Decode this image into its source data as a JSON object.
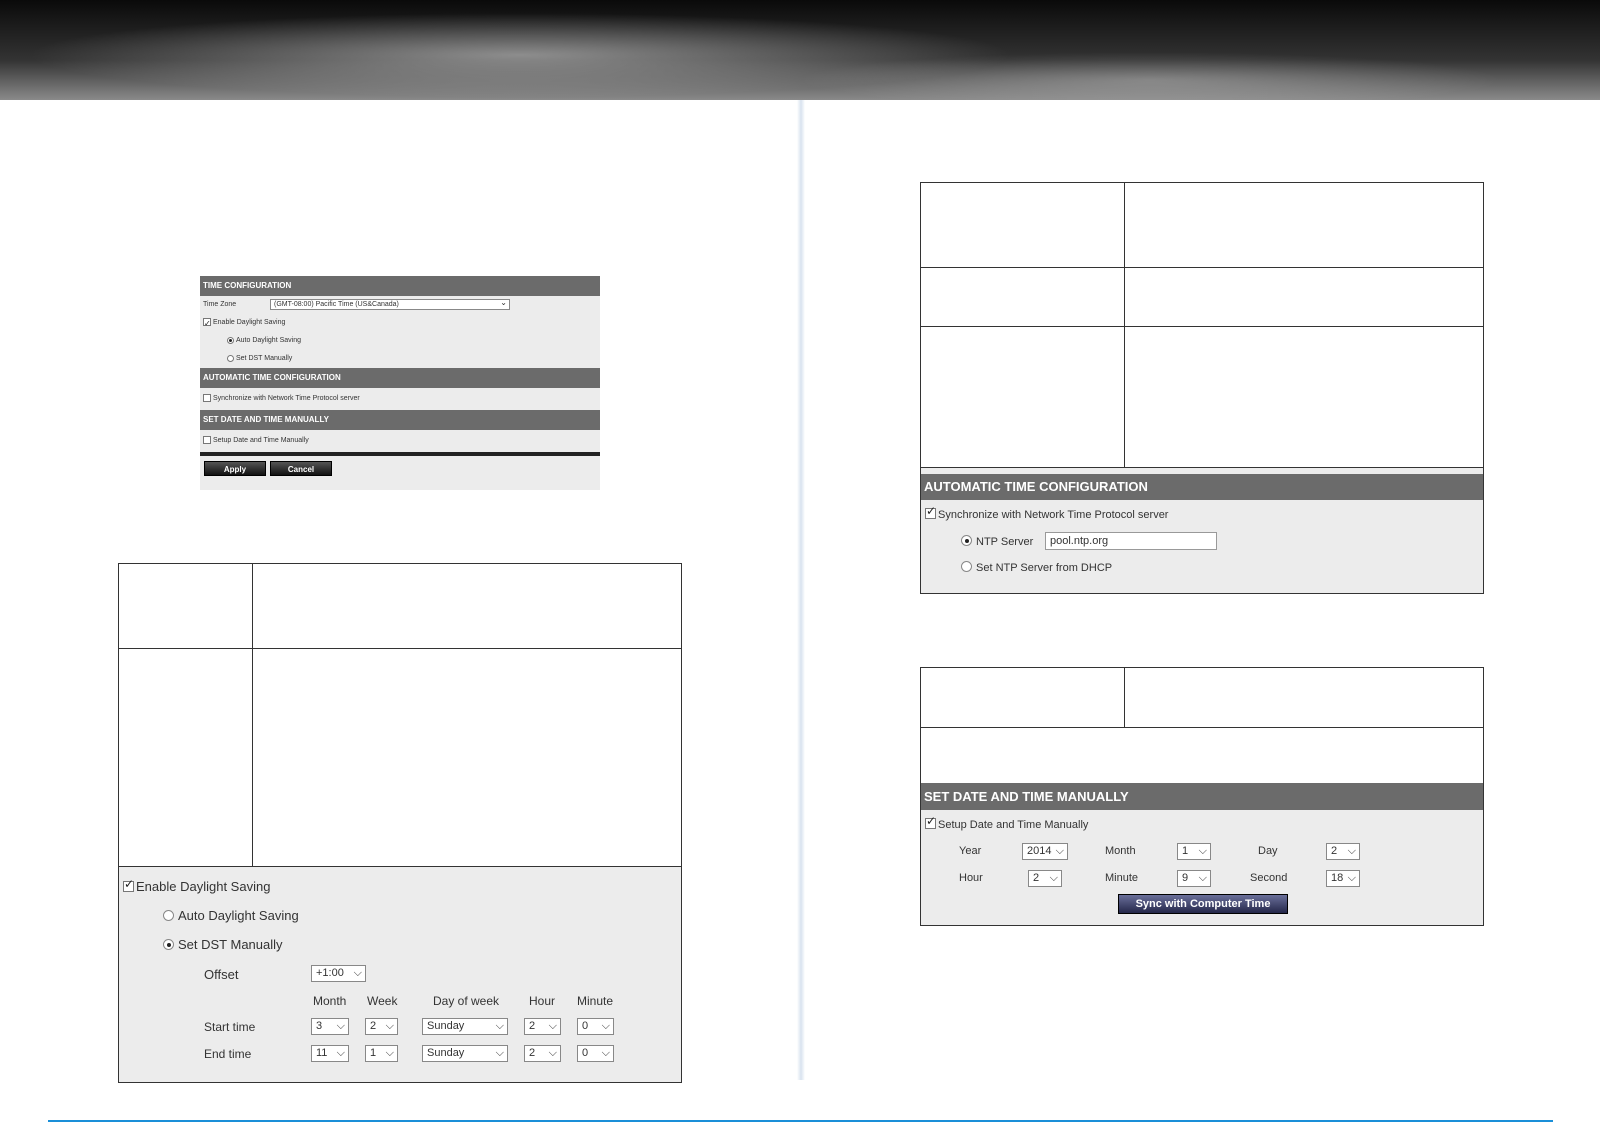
{
  "shot": {
    "time_config_title": "TIME CONFIGURATION",
    "time_zone_label": "Time Zone",
    "time_zone_value": "(GMT-08:00) Pacific Time (US&Canada)",
    "enable_dst": "Enable Daylight Saving",
    "auto_dst": "Auto Daylight Saving",
    "set_dst_manual": "Set DST Manually",
    "auto_time_title": "AUTOMATIC TIME CONFIGURATION",
    "sync_ntp": "Synchronize with Network Time Protocol server",
    "manual_title": "SET DATE AND TIME MANUALLY",
    "setup_manual": "Setup Date and Time Manually",
    "apply": "Apply",
    "cancel": "Cancel"
  },
  "dst": {
    "enable": "Enable Daylight Saving",
    "auto": "Auto Daylight Saving",
    "manual": "Set DST Manually",
    "offset_label": "Offset",
    "offset_value": "+1:00",
    "col_month": "Month",
    "col_week": "Week",
    "col_dow": "Day of week",
    "col_hour": "Hour",
    "col_minute": "Minute",
    "start_label": "Start time",
    "end_label": "End time",
    "start": {
      "month": "3",
      "week": "2",
      "dow": "Sunday",
      "hour": "2",
      "minute": "0"
    },
    "end": {
      "month": "11",
      "week": "1",
      "dow": "Sunday",
      "hour": "2",
      "minute": "0"
    }
  },
  "ntp": {
    "title": "AUTOMATIC TIME CONFIGURATION",
    "sync": "Synchronize with Network Time Protocol server",
    "server_label": "NTP Server",
    "server_value": "pool.ntp.org",
    "dhcp_label": "Set NTP Server from DHCP"
  },
  "manual": {
    "title": "SET DATE AND TIME MANUALLY",
    "setup": "Setup Date and Time Manually",
    "year_label": "Year",
    "year": "2014",
    "month_label": "Month",
    "month": "1",
    "day_label": "Day",
    "day": "2",
    "hour_label": "Hour",
    "hour": "2",
    "minute_label": "Minute",
    "minute": "9",
    "second_label": "Second",
    "second": "18",
    "sync_button": "Sync with Computer Time"
  }
}
